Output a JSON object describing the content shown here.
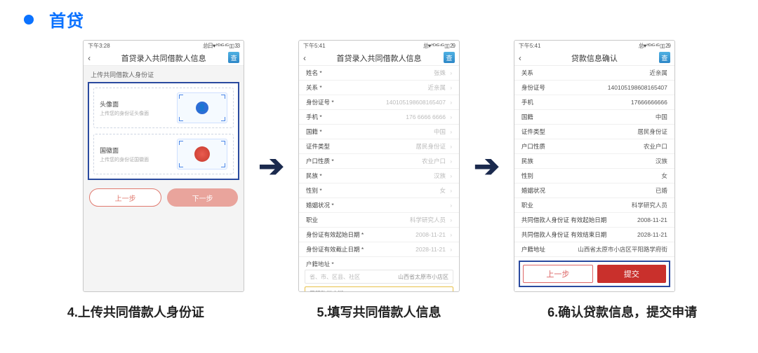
{
  "header": {
    "title": "首贷"
  },
  "phone1": {
    "time": "下午3:28",
    "signal": "总日♥ ᴴᴰ⁴ᴳ ⁴ᴳ ▯▯ 33",
    "title": "首贷录入共同借款人信息",
    "section": "上传共同借款人身份证",
    "front_label": "头像面",
    "front_sub": "上传您的身份证头像面",
    "back_label": "国徽面",
    "back_sub": "上传您的身份证国徽面",
    "prev": "上一步",
    "next": "下一步",
    "cha": "查"
  },
  "phone2": {
    "time": "下午5:41",
    "signal": "总♥ ᴴᴰ⁴ᴳ ⁴ᴳ ▯▯ 29",
    "title": "首贷录入共同借款人信息",
    "cha": "查",
    "rows": [
      {
        "lbl": "姓名 *",
        "val": "张姝"
      },
      {
        "lbl": "关系 *",
        "val": "近亲属"
      },
      {
        "lbl": "身份证号 *",
        "val": "140105198608165407"
      },
      {
        "lbl": "手机 *",
        "val": "176 6666 6666"
      },
      {
        "lbl": "国籍 *",
        "val": "中国"
      },
      {
        "lbl": "证件类型",
        "val": "居民身份证"
      },
      {
        "lbl": "户口性质 *",
        "val": "农业户口"
      },
      {
        "lbl": "民族 *",
        "val": "汉族"
      },
      {
        "lbl": "性别 *",
        "val": "女"
      },
      {
        "lbl": "婚姻状况 *",
        "val": ""
      },
      {
        "lbl": "职业",
        "val": "科学研究人员"
      },
      {
        "lbl": "身份证有效起始日期 *",
        "val": "2008-11-21"
      },
      {
        "lbl": "身份证有效截止日期 *",
        "val": "2028-11-21"
      }
    ],
    "addr_label": "户籍地址 *",
    "addr_ph": "省、市、区县、社区",
    "addr_val": "山西省太原市小店区",
    "street": "平阳路学府街"
  },
  "phone3": {
    "time": "下午5:41",
    "signal": "总♥ ᴴᴰ⁴ᴳ ⁴ᴳ ▯▯ 29",
    "title": "贷款信息确认",
    "cha": "查",
    "rows": [
      {
        "lbl": "关系",
        "val": "近亲属"
      },
      {
        "lbl": "身份证号",
        "val": "140105198608165407"
      },
      {
        "lbl": "手机",
        "val": "17666666666"
      },
      {
        "lbl": "国籍",
        "val": "中国"
      },
      {
        "lbl": "证件类型",
        "val": "居民身份证"
      },
      {
        "lbl": "户口性质",
        "val": "农业户口"
      },
      {
        "lbl": "民族",
        "val": "汉族"
      },
      {
        "lbl": "性别",
        "val": "女"
      },
      {
        "lbl": "婚姻状况",
        "val": "已婚"
      },
      {
        "lbl": "职业",
        "val": "科学研究人员"
      },
      {
        "lbl": "共同借款人身份证 有效起始日期",
        "val": "2008-11-21"
      },
      {
        "lbl": "共同借款人身份证 有效结束日期",
        "val": "2028-11-21"
      },
      {
        "lbl": "户籍地址",
        "val": "山西省太原市小店区平阳路学府街"
      }
    ],
    "prev": "上一步",
    "submit": "提交"
  },
  "captions": {
    "c1": "4.上传共同借款人身份证",
    "c2": "5.填写共同借款人信息",
    "c3": "6.确认贷款信息，提交申请"
  }
}
